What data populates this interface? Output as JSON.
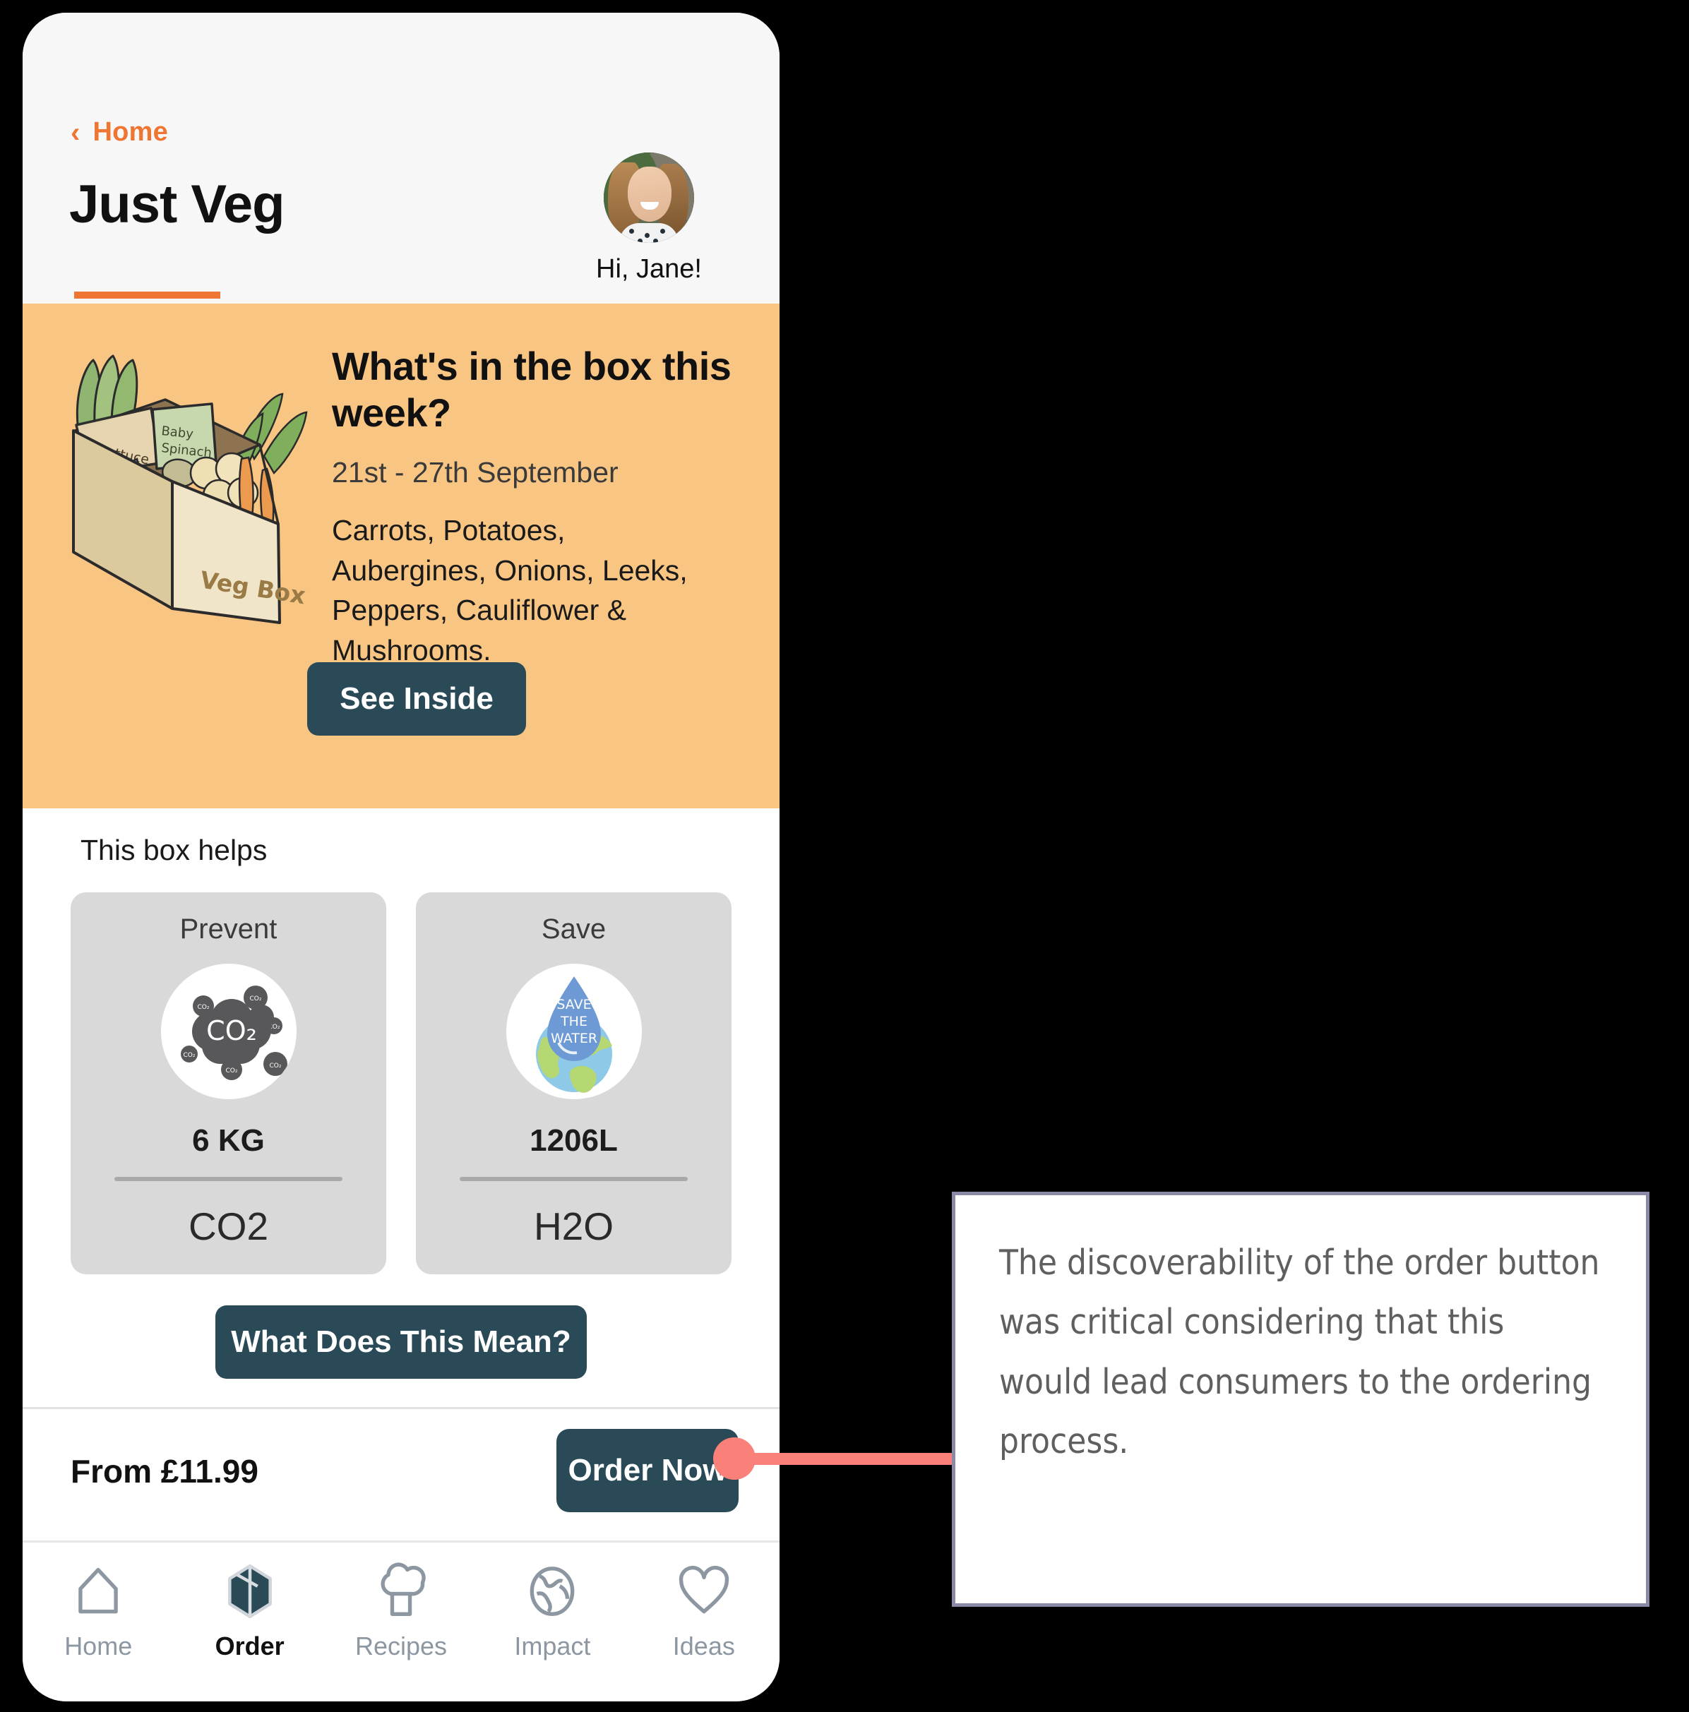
{
  "phone": {
    "header": {
      "back_label": "Home",
      "back_icon": "chevron-left-icon",
      "app_title": "Just Veg",
      "greeting": "Hi, Jane!",
      "avatar_alt": "Jane profile photo"
    },
    "banner": {
      "heading": "What's in the box this week?",
      "date_range": "21st - 27th September",
      "contents": "Carrots, Potatoes, Aubergines, Onions, Leeks, Peppers, Cauliflower & Mushrooms.",
      "cta_label": "See Inside",
      "illustration_alt": "Veg Box",
      "illustration_labels": [
        "Lettuce",
        "Baby Spinach",
        "Veg Box"
      ],
      "background_color": "#F9C583"
    },
    "impact": {
      "section_label": "This box helps",
      "cards": [
        {
          "kicker": "Prevent",
          "icon": "co2-cloud-icon",
          "icon_text": "CO2",
          "value": "6 KG",
          "unit": "CO2"
        },
        {
          "kicker": "Save",
          "icon": "save-the-water-globe-icon",
          "icon_text": "SAVE THE WATER",
          "value": "1206L",
          "unit": "H2O"
        }
      ],
      "explain_button": "What Does This Mean?"
    },
    "price_bar": {
      "price_label": "From £11.99",
      "order_label": "Order Now"
    },
    "nav": [
      {
        "label": "Home",
        "icon": "house-icon",
        "active": false
      },
      {
        "label": "Order",
        "icon": "box-icon",
        "active": true
      },
      {
        "label": "Recipes",
        "icon": "chef-hat-icon",
        "active": false
      },
      {
        "label": "Impact",
        "icon": "globe-icon",
        "active": false
      },
      {
        "label": "Ideas",
        "icon": "heart-icon",
        "active": false
      }
    ]
  },
  "annotation": {
    "text": "The discoverability of the order button was critical considering that this would lead consumers to the ordering process.",
    "connector_color": "#F9817A",
    "border_color": "#8A8AA6"
  },
  "theme": {
    "accent_orange": "#EF7632",
    "banner_orange": "#F9C583",
    "dark_button": "#2B4A58",
    "card_gray": "#D9D9D9",
    "page_background": "#000000"
  }
}
